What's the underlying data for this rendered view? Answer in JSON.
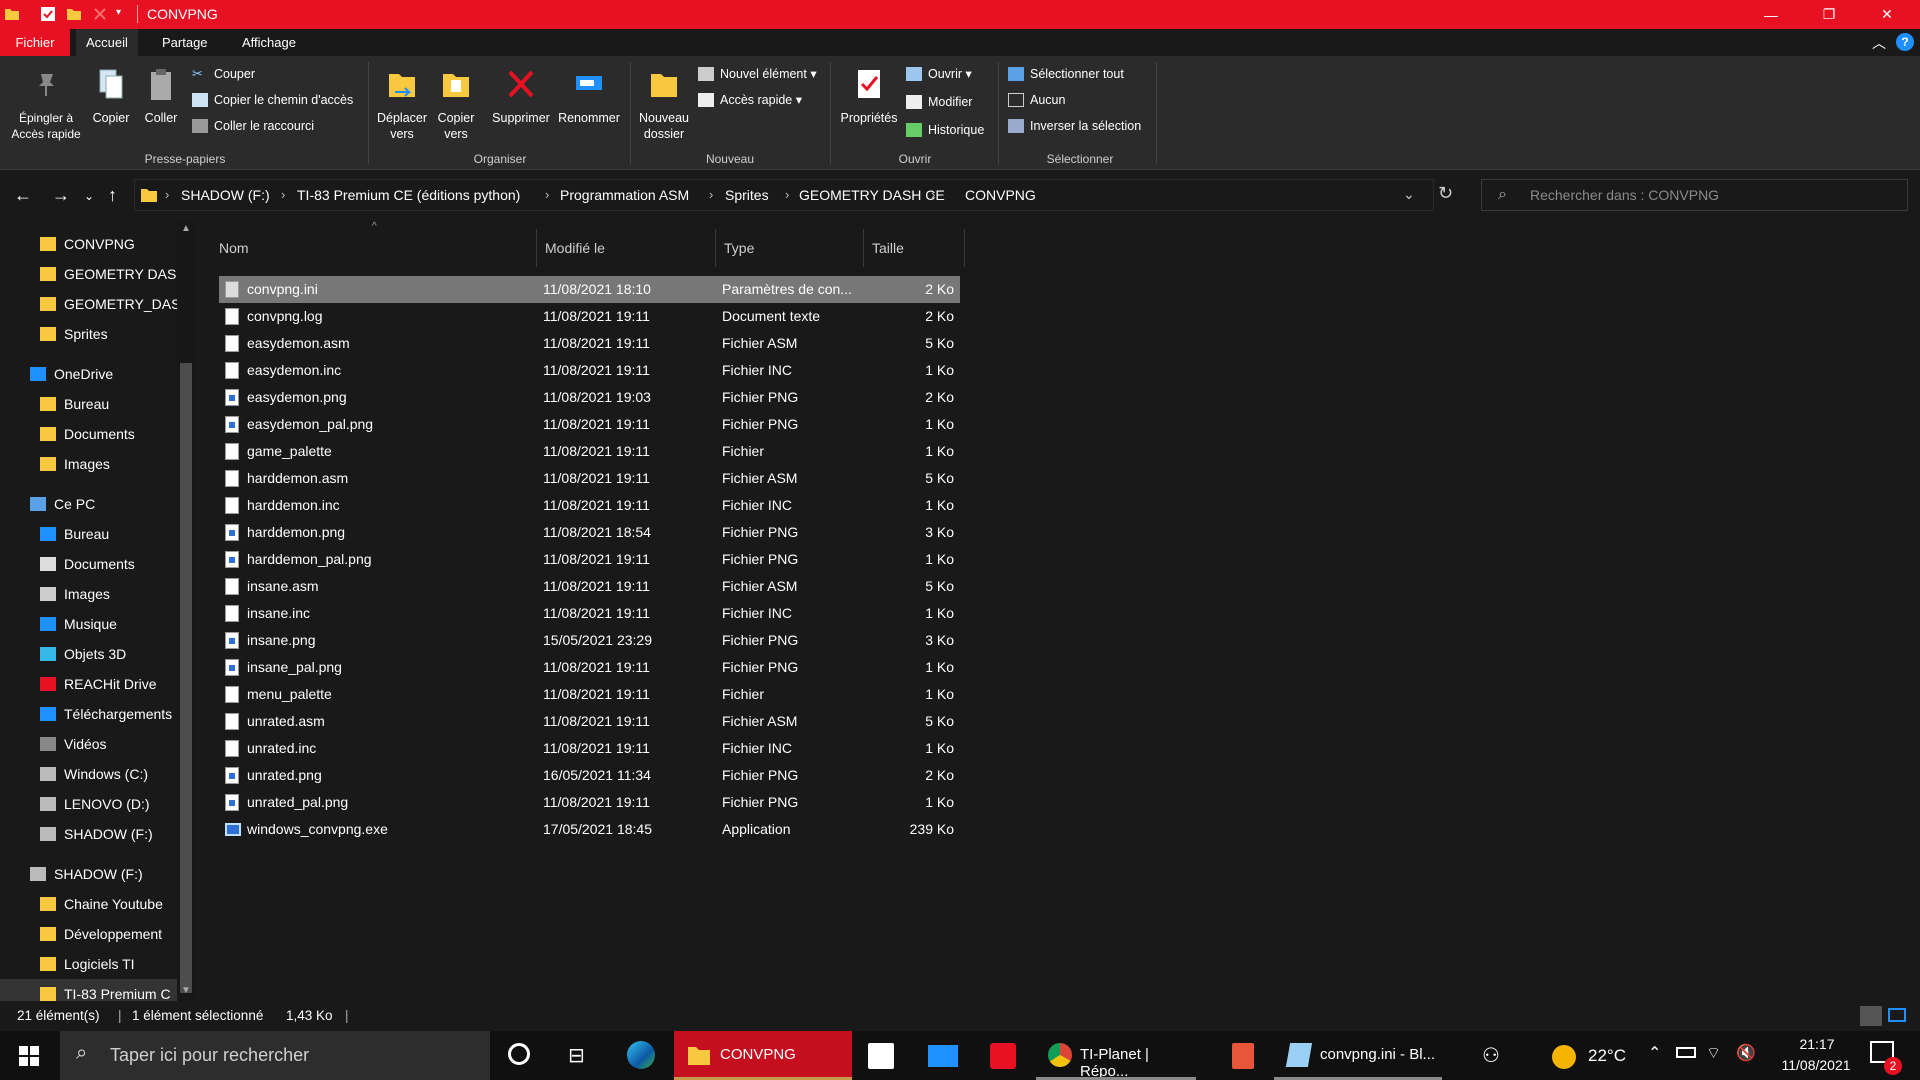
{
  "window": {
    "title": "CONVPNG",
    "minimize_icon": "minimize-icon",
    "maximize_icon": "restore-icon",
    "close_icon": "close-icon"
  },
  "tabs": {
    "file": "Fichier",
    "home": "Accueil",
    "share": "Partage",
    "view": "Affichage"
  },
  "ribbon": {
    "pin": "Épingler à Accès rapide",
    "copy": "Copier",
    "paste": "Coller",
    "cut": "Couper",
    "copy_path": "Copier le chemin d'accès",
    "paste_shortcut": "Coller le raccourci",
    "group_clipboard": "Presse-papiers",
    "move_to": "Déplacer vers",
    "copy_to": "Copier vers",
    "delete": "Supprimer",
    "rename": "Renommer",
    "group_organize": "Organiser",
    "new_folder": "Nouveau dossier",
    "new_item": "Nouvel élément",
    "easy_access": "Accès rapide",
    "group_new": "Nouveau",
    "properties": "Propriétés",
    "open": "Ouvrir",
    "edit": "Modifier",
    "history": "Historique",
    "group_open": "Ouvrir",
    "select_all": "Sélectionner tout",
    "select_none": "Aucun",
    "invert_selection": "Inverser la sélection",
    "group_select": "Sélectionner"
  },
  "address": {
    "crumbs": [
      "SHADOW (F:)",
      "TI-83 Premium CE (éditions python)",
      "Programmation ASM",
      "Sprites",
      "GEOMETRY DASH CE",
      "CONVPNG"
    ],
    "search_placeholder": "Rechercher dans : CONVPNG"
  },
  "nav": {
    "items": [
      {
        "label": "CONVPNG",
        "icon": "folder-icon"
      },
      {
        "label": "GEOMETRY DAS",
        "icon": "folder-icon"
      },
      {
        "label": "GEOMETRY_DAS",
        "icon": "folder-icon"
      },
      {
        "label": "Sprites",
        "icon": "folder-icon"
      },
      {
        "label": "OneDrive",
        "icon": "cloud-icon"
      },
      {
        "label": "Bureau",
        "icon": "folder-icon"
      },
      {
        "label": "Documents",
        "icon": "folder-icon"
      },
      {
        "label": "Images",
        "icon": "folder-icon"
      },
      {
        "label": "Ce PC",
        "icon": "computer-icon"
      },
      {
        "label": "Bureau",
        "icon": "desktop-icon"
      },
      {
        "label": "Documents",
        "icon": "documents-icon"
      },
      {
        "label": "Images",
        "icon": "pictures-icon"
      },
      {
        "label": "Musique",
        "icon": "music-icon"
      },
      {
        "label": "Objets 3D",
        "icon": "cube-icon"
      },
      {
        "label": "REACHit Drive",
        "icon": "drive-icon"
      },
      {
        "label": "Téléchargements",
        "icon": "download-icon"
      },
      {
        "label": "Vidéos",
        "icon": "video-icon"
      },
      {
        "label": "Windows (C:)",
        "icon": "disk-icon"
      },
      {
        "label": "LENOVO (D:)",
        "icon": "disk-icon"
      },
      {
        "label": "SHADOW (F:)",
        "icon": "disk-icon"
      },
      {
        "label": "SHADOW (F:)",
        "icon": "disk-icon"
      },
      {
        "label": "Chaine Youtube",
        "icon": "folder-icon"
      },
      {
        "label": "Développement",
        "icon": "folder-icon"
      },
      {
        "label": "Logiciels TI",
        "icon": "folder-icon"
      },
      {
        "label": "TI-83 Premium C",
        "icon": "folder-icon"
      }
    ]
  },
  "columns": {
    "name": "Nom",
    "modified": "Modifié le",
    "type": "Type",
    "size": "Taille"
  },
  "files": [
    {
      "name": "convpng.ini",
      "date": "11/08/2021 18:10",
      "type": "Paramètres de con...",
      "size": "2 Ko",
      "kind": "ini"
    },
    {
      "name": "convpng.log",
      "date": "11/08/2021 19:11",
      "type": "Document texte",
      "size": "2 Ko",
      "kind": "doc"
    },
    {
      "name": "easydemon.asm",
      "date": "11/08/2021 19:11",
      "type": "Fichier ASM",
      "size": "5 Ko",
      "kind": "doc"
    },
    {
      "name": "easydemon.inc",
      "date": "11/08/2021 19:11",
      "type": "Fichier INC",
      "size": "1 Ko",
      "kind": "doc"
    },
    {
      "name": "easydemon.png",
      "date": "11/08/2021 19:03",
      "type": "Fichier PNG",
      "size": "2 Ko",
      "kind": "png"
    },
    {
      "name": "easydemon_pal.png",
      "date": "11/08/2021 19:11",
      "type": "Fichier PNG",
      "size": "1 Ko",
      "kind": "png"
    },
    {
      "name": "game_palette",
      "date": "11/08/2021 19:11",
      "type": "Fichier",
      "size": "1 Ko",
      "kind": "doc"
    },
    {
      "name": "harddemon.asm",
      "date": "11/08/2021 19:11",
      "type": "Fichier ASM",
      "size": "5 Ko",
      "kind": "doc"
    },
    {
      "name": "harddemon.inc",
      "date": "11/08/2021 19:11",
      "type": "Fichier INC",
      "size": "1 Ko",
      "kind": "doc"
    },
    {
      "name": "harddemon.png",
      "date": "11/08/2021 18:54",
      "type": "Fichier PNG",
      "size": "3 Ko",
      "kind": "png"
    },
    {
      "name": "harddemon_pal.png",
      "date": "11/08/2021 19:11",
      "type": "Fichier PNG",
      "size": "1 Ko",
      "kind": "png"
    },
    {
      "name": "insane.asm",
      "date": "11/08/2021 19:11",
      "type": "Fichier ASM",
      "size": "5 Ko",
      "kind": "doc"
    },
    {
      "name": "insane.inc",
      "date": "11/08/2021 19:11",
      "type": "Fichier INC",
      "size": "1 Ko",
      "kind": "doc"
    },
    {
      "name": "insane.png",
      "date": "15/05/2021 23:29",
      "type": "Fichier PNG",
      "size": "3 Ko",
      "kind": "png"
    },
    {
      "name": "insane_pal.png",
      "date": "11/08/2021 19:11",
      "type": "Fichier PNG",
      "size": "1 Ko",
      "kind": "png"
    },
    {
      "name": "menu_palette",
      "date": "11/08/2021 19:11",
      "type": "Fichier",
      "size": "1 Ko",
      "kind": "doc"
    },
    {
      "name": "unrated.asm",
      "date": "11/08/2021 19:11",
      "type": "Fichier ASM",
      "size": "5 Ko",
      "kind": "doc"
    },
    {
      "name": "unrated.inc",
      "date": "11/08/2021 19:11",
      "type": "Fichier INC",
      "size": "1 Ko",
      "kind": "doc"
    },
    {
      "name": "unrated.png",
      "date": "16/05/2021 11:34",
      "type": "Fichier PNG",
      "size": "2 Ko",
      "kind": "png"
    },
    {
      "name": "unrated_pal.png",
      "date": "11/08/2021 19:11",
      "type": "Fichier PNG",
      "size": "1 Ko",
      "kind": "png"
    },
    {
      "name": "windows_convpng.exe",
      "date": "17/05/2021 18:45",
      "type": "Application",
      "size": "239 Ko",
      "kind": "exe"
    }
  ],
  "status": {
    "count": "21 élément(s)",
    "selected": "1 élément sélectionné",
    "selected_size": "1,43 Ko"
  },
  "taskbar": {
    "search_placeholder": "Taper ici pour rechercher",
    "apps": [
      {
        "label": "CONVPNG",
        "icon": "folder-icon"
      },
      {
        "label": "TI-Planet | Répo...",
        "icon": "chrome-icon"
      },
      {
        "label": "convpng.ini - Bl...",
        "icon": "notepad-icon"
      }
    ],
    "weather": "22°C",
    "time": "21:17",
    "date": "11/08/2021",
    "notification_count": "2"
  },
  "colors": {
    "accent": "#e81123",
    "selection": "#777777",
    "background": "#191919",
    "ribbon": "#2b2b2b"
  }
}
